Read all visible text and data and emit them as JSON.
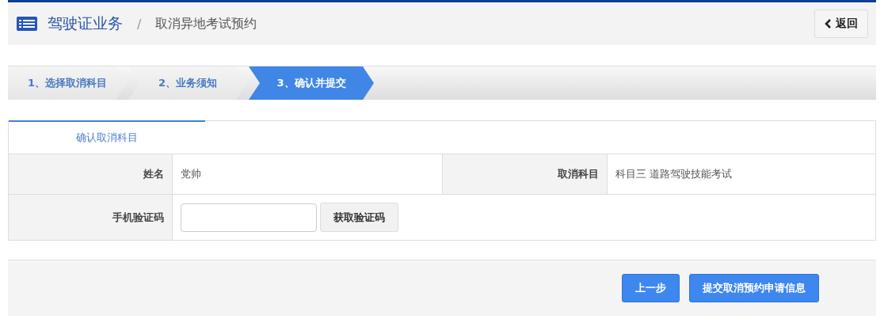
{
  "header": {
    "section": "驾驶证业务",
    "separator": "/",
    "page": "取消异地考试预约",
    "back_button": "返回"
  },
  "steps": [
    {
      "label": "1、选择取消科目",
      "selected": false
    },
    {
      "label": "2、业务须知",
      "selected": false
    },
    {
      "label": "3、确认并提交",
      "selected": true
    }
  ],
  "tabs": [
    {
      "label": "确认取消科目",
      "selected": true
    }
  ],
  "form_rows": [
    {
      "fields": [
        {
          "kind": "text",
          "label": "姓名",
          "value": "党帅"
        },
        {
          "kind": "text",
          "label": "取消科目",
          "value": "科目三 道路驾驶技能考试"
        }
      ]
    },
    {
      "fields": [
        {
          "kind": "code",
          "label": "手机验证码",
          "button": "获取验证码"
        }
      ]
    }
  ],
  "buttons": [
    "上一步",
    "提交取消预约申请信息"
  ]
}
